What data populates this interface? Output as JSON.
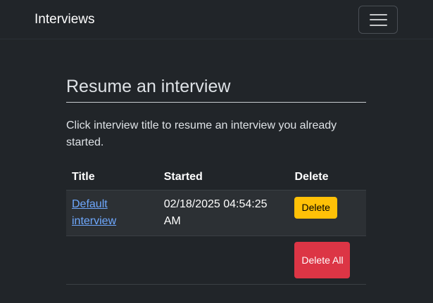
{
  "navbar": {
    "brand": "Interviews",
    "toggle_icon": "hamburger-menu-icon"
  },
  "page": {
    "heading": "Resume an interview",
    "intro": "Click interview title to resume an interview you already started."
  },
  "table": {
    "headers": {
      "title": "Title",
      "started": "Started",
      "delete": "Delete"
    },
    "rows": [
      {
        "title": "Default interview",
        "started": "02/18/2025 04:54:25 AM",
        "delete_label": "Delete"
      }
    ],
    "delete_all_label": "Delete All"
  },
  "colors": {
    "background": "#212529",
    "link": "#6ea8fe",
    "warning_button": "#ffc107",
    "danger_button": "#dc3545"
  }
}
